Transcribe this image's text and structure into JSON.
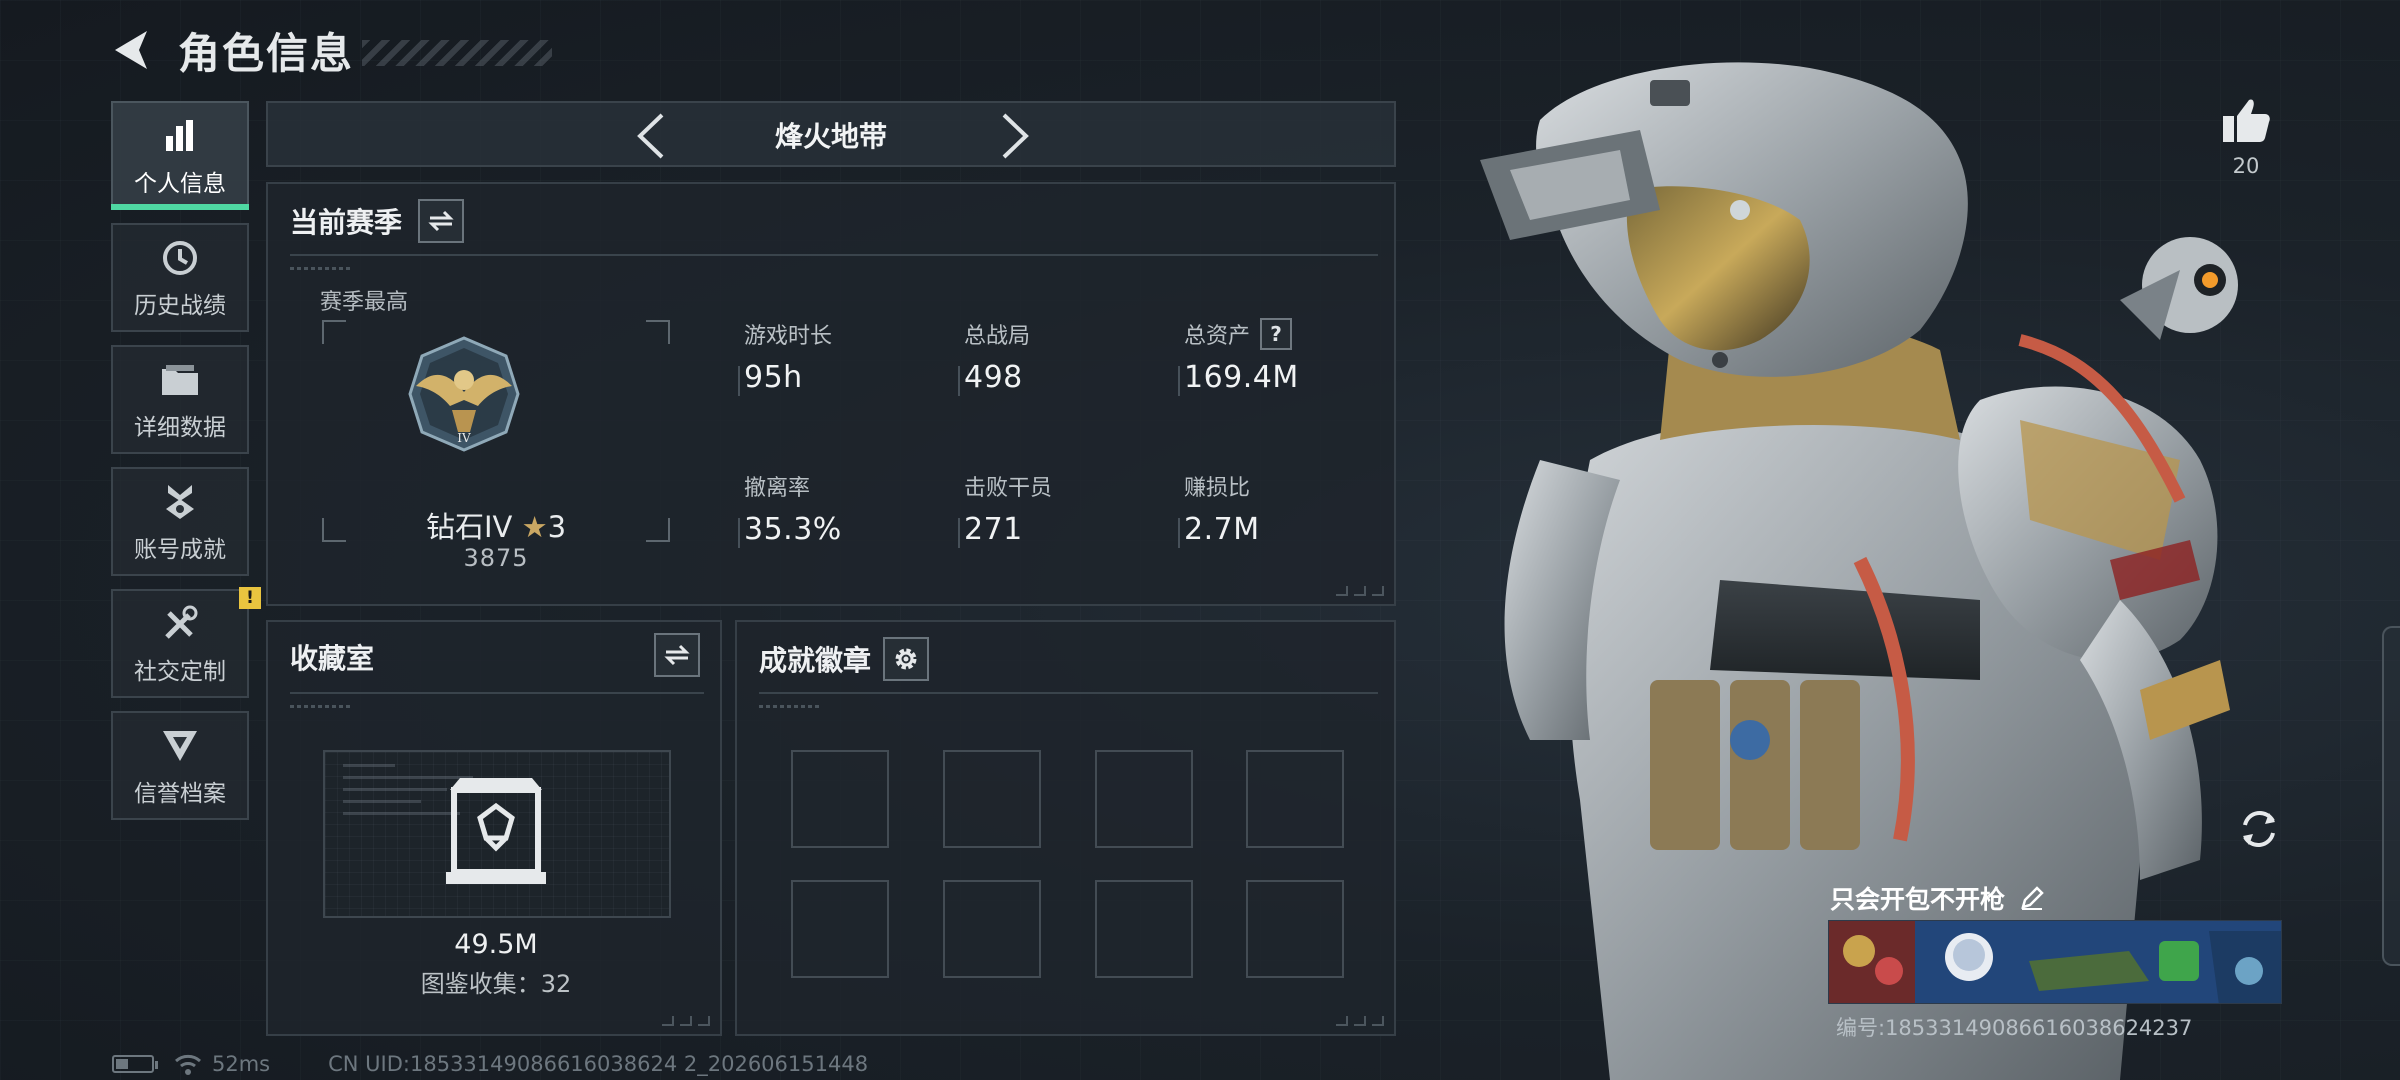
{
  "header": {
    "title": "角色信息"
  },
  "nav": {
    "items": [
      {
        "label": "个人信息",
        "icon": "bar-chart-icon",
        "active": true
      },
      {
        "label": "历史战绩",
        "icon": "history-clock-icon"
      },
      {
        "label": "详细数据",
        "icon": "folder-icon"
      },
      {
        "label": "账号成就",
        "icon": "medal-icon"
      },
      {
        "label": "社交定制",
        "icon": "tools-icon",
        "badge": "!"
      },
      {
        "label": "信誉档案",
        "icon": "shield-emblem-icon"
      }
    ]
  },
  "map_selector": {
    "name": "烽火地带"
  },
  "season": {
    "title": "当前赛季",
    "best_label": "赛季最高",
    "rank_name": "钻石IV",
    "rank_stars": "3",
    "rank_score": "3875",
    "stats": [
      {
        "label": "游戏时长",
        "value": "95h"
      },
      {
        "label": "总战局",
        "value": "498"
      },
      {
        "label": "总资产",
        "value": "169.4M",
        "help": "?"
      },
      {
        "label": "撤离率",
        "value": "35.3%"
      },
      {
        "label": "击败干员",
        "value": "271"
      },
      {
        "label": "赚损比",
        "value": "2.7M"
      }
    ]
  },
  "collection": {
    "title": "收藏室",
    "value": "49.5M",
    "count_text": "图鉴收集：32"
  },
  "achievements": {
    "title": "成就徽章",
    "slot_count": 8
  },
  "profile": {
    "likes": "20",
    "card_name": "只会开包不开枪",
    "card_id": "编号:18533149086616038624237"
  },
  "status": {
    "ping": "52ms",
    "uid": "CN UID:18533149086616038624 2_202606151448"
  },
  "colors": {
    "accent": "#4fd9a3",
    "warning": "#e9c43f",
    "gold": "#c9a763"
  }
}
